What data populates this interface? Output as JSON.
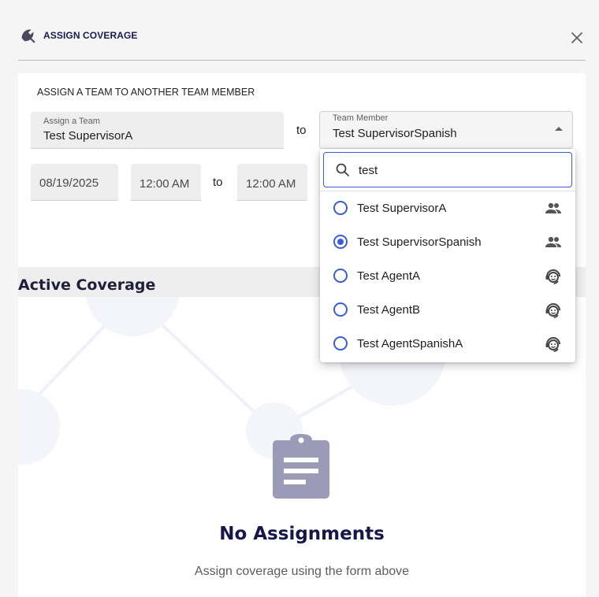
{
  "header": {
    "title": "ASSIGN COVERAGE",
    "logo_icon": "umbrella-icon",
    "close_icon": "close-icon"
  },
  "form": {
    "heading": "ASSIGN A TEAM TO ANOTHER TEAM MEMBER",
    "assign_team": {
      "label": "Assign a Team",
      "value": "Test SupervisorA"
    },
    "to_label": "to",
    "team_member": {
      "label": "Team Member",
      "value": "Test SupervisorSpanish"
    },
    "date": "08/19/2025",
    "start_time": "12:00 AM",
    "time_to_label": "to",
    "end_time": "12:00 AM"
  },
  "dropdown": {
    "search_value": "test",
    "search_icon": "search-icon",
    "options": [
      {
        "label": "Test SupervisorA",
        "selected": false,
        "icon": "group-icon"
      },
      {
        "label": "Test SupervisorSpanish",
        "selected": true,
        "icon": "group-icon"
      },
      {
        "label": "Test AgentA",
        "selected": false,
        "icon": "support-agent-icon"
      },
      {
        "label": "Test AgentB",
        "selected": false,
        "icon": "support-agent-icon"
      },
      {
        "label": "Test AgentSpanishA",
        "selected": false,
        "icon": "support-agent-icon"
      }
    ]
  },
  "active_coverage": {
    "title": "Active Coverage",
    "empty_icon": "clipboard-icon",
    "empty_title": "No Assignments",
    "empty_subtitle": "Assign coverage using the form above"
  },
  "colors": {
    "accent": "#3b5bdb",
    "heading": "#16164a",
    "icon_gray": "#9b9bb8"
  }
}
